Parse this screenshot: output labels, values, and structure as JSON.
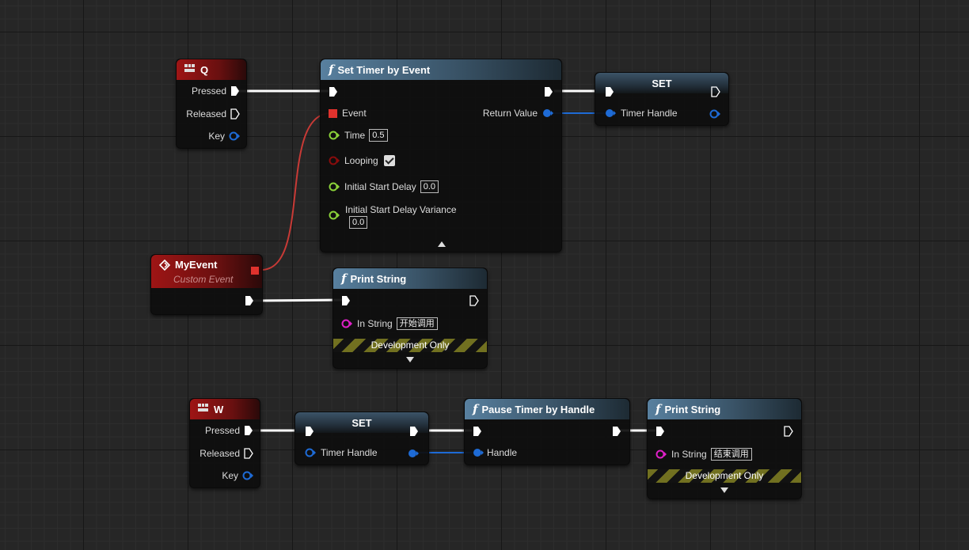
{
  "nodes": {
    "q_event": {
      "title": "Q",
      "icon": "keyboard-icon",
      "pins": {
        "pressed": "Pressed",
        "released": "Released",
        "key": "Key"
      }
    },
    "set_timer": {
      "title": "Set Timer by Event",
      "pins": {
        "event": "Event",
        "return_value": "Return Value",
        "time": "Time",
        "time_value": "0.5",
        "looping": "Looping",
        "looping_checked": true,
        "initial_start_delay": "Initial Start Delay",
        "initial_start_delay_value": "0.0",
        "initial_start_delay_variance": "Initial Start Delay Variance",
        "initial_start_delay_variance_value": "0.0"
      }
    },
    "set_top": {
      "title": "SET",
      "pins": {
        "timer_handle": "Timer Handle"
      }
    },
    "my_event": {
      "title": "MyEvent",
      "subtitle": "Custom Event"
    },
    "print_top": {
      "title": "Print String",
      "pins": {
        "in_string": "In String",
        "in_string_value": "开始调用"
      },
      "dev_only": "Development Only"
    },
    "w_event": {
      "title": "W",
      "icon": "keyboard-icon",
      "pins": {
        "pressed": "Pressed",
        "released": "Released",
        "key": "Key"
      }
    },
    "set_bottom": {
      "title": "SET",
      "pins": {
        "timer_handle": "Timer Handle"
      }
    },
    "pause_timer": {
      "title": "Pause Timer by Handle",
      "pins": {
        "handle": "Handle"
      }
    },
    "print_bottom": {
      "title": "Print String",
      "pins": {
        "in_string": "In String",
        "in_string_value": "结束调用"
      },
      "dev_only": "Development Only"
    }
  },
  "colors": {
    "exec": "#ffffff",
    "struct_handle": "#1e6bd6",
    "float": "#8bd23a",
    "bool": "#8a0c0c",
    "string": "#e020c8",
    "delegate": "#e0322d",
    "function_header": "#58809f",
    "event_header": "#9e1515"
  }
}
